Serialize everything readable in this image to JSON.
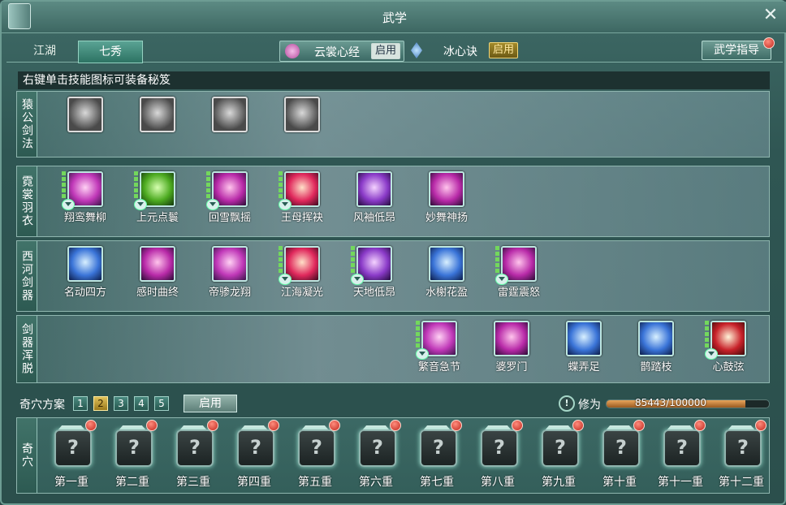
{
  "window": {
    "title": "武学",
    "close_icon": "close-icon"
  },
  "tabs": [
    {
      "label": "江湖"
    },
    {
      "label": "七秀"
    }
  ],
  "xinjing": [
    {
      "name": "云裳心经",
      "button": "启用",
      "icon": "lotus-icon"
    },
    {
      "name": "冰心诀",
      "button": "启用",
      "icon": "crystal-icon"
    }
  ],
  "guide_button": "武学指导",
  "hint": "右键单击技能图标可装备秘笈",
  "sections": [
    {
      "label": "猿公剑法",
      "skills": [
        {
          "name": "",
          "color": "gray",
          "miji": false
        },
        {
          "name": "",
          "color": "gray",
          "miji": false
        },
        {
          "name": "",
          "color": "gray",
          "miji": false
        },
        {
          "name": "",
          "color": "gray",
          "miji": false
        }
      ]
    },
    {
      "label": "霓裳羽衣",
      "skills": [
        {
          "name": "翔鸾舞柳",
          "color": "pink",
          "miji": true
        },
        {
          "name": "上元点鬟",
          "color": "green",
          "miji": true
        },
        {
          "name": "回雪飘摇",
          "color": "magenta",
          "miji": true
        },
        {
          "name": "王母挥袂",
          "color": "red",
          "miji": true
        },
        {
          "name": "风袖低昂",
          "color": "violet",
          "miji": false
        },
        {
          "name": "妙舞神扬",
          "color": "magenta",
          "miji": false
        }
      ]
    },
    {
      "label": "西河剑器",
      "skills": [
        {
          "name": "名动四方",
          "color": "blue",
          "miji": false
        },
        {
          "name": "感时曲终",
          "color": "magenta",
          "miji": false
        },
        {
          "name": "帝骖龙翔",
          "color": "pink",
          "miji": false
        },
        {
          "name": "江海凝光",
          "color": "red",
          "miji": true
        },
        {
          "name": "天地低昂",
          "color": "violet",
          "miji": true
        },
        {
          "name": "水榭花盈",
          "color": "blue",
          "miji": false
        },
        {
          "name": "雷霆震怒",
          "color": "magenta",
          "miji": true
        }
      ]
    },
    {
      "label": "剑器浑脱",
      "skills": [
        {
          "name": "繁音急节",
          "color": "pink",
          "miji": true
        },
        {
          "name": "婆罗门",
          "color": "magenta",
          "miji": false
        },
        {
          "name": "蝶弄足",
          "color": "blue",
          "miji": false
        },
        {
          "name": "鹊踏枝",
          "color": "blue",
          "miji": false
        },
        {
          "name": "心鼓弦",
          "color": "orangered",
          "miji": true
        }
      ]
    }
  ],
  "qixue": {
    "plan_label": "奇穴方案",
    "plans": [
      "1",
      "2",
      "3",
      "4",
      "5"
    ],
    "active_plan": "2",
    "enable_button": "启用",
    "side_label": "奇穴",
    "slot_glyph": "?",
    "slots": [
      "第一重",
      "第二重",
      "第三重",
      "第四重",
      "第五重",
      "第六重",
      "第七重",
      "第八重",
      "第九重",
      "第十重",
      "第十一重",
      "第十二重"
    ]
  },
  "cultivation": {
    "label": "修为",
    "text": "85443/100000",
    "current": 85443,
    "max": 100000,
    "info_icon": "!"
  }
}
